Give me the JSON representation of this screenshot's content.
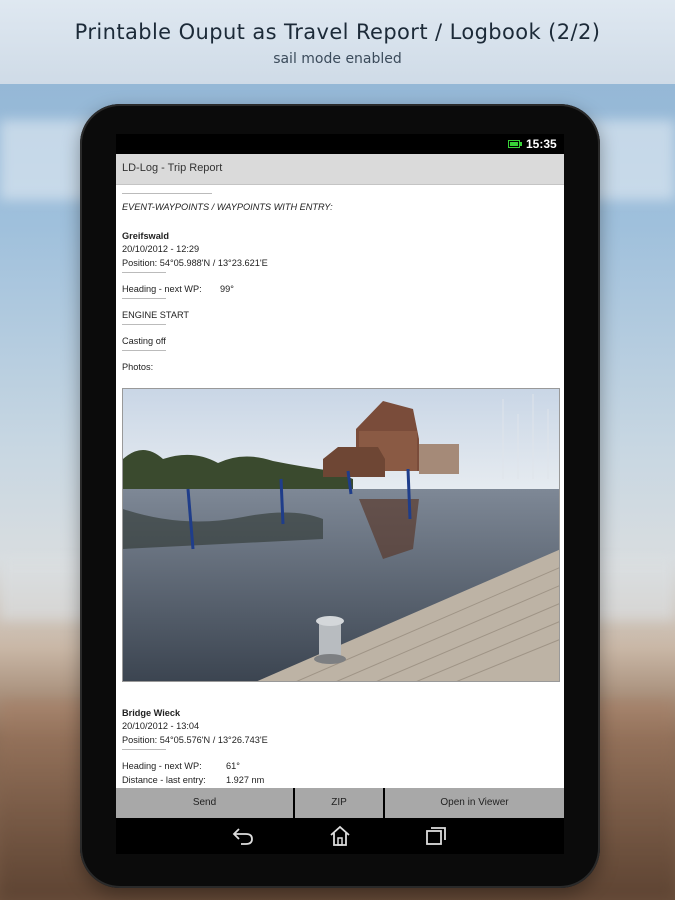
{
  "header": {
    "title": "Printable Ouput as Travel Report / Logbook (2/2)",
    "subtitle": "sail mode enabled"
  },
  "status_bar": {
    "time": "15:35"
  },
  "app_bar": {
    "title": "LD-Log - Trip Report"
  },
  "report": {
    "section_heading": "EVENT-WAYPOINTS / WAYPOINTS WITH ENTRY:",
    "waypoint1": {
      "name": "Greifswald",
      "datetime": "20/10/2012 - 12:29",
      "position": "Position: 54°05.988'N / 13°23.621'E",
      "heading": "Heading - next WP:",
      "heading_value": "99°",
      "event1": "ENGINE START",
      "event2": "Casting off",
      "photos_label": "Photos:"
    },
    "waypoint2": {
      "name": "Bridge Wieck",
      "datetime": "20/10/2012 - 13:04",
      "position": "Position: 54°05.576'N / 13°26.743'E",
      "heading": "Heading - next WP:",
      "heading_value": "61°",
      "distance": "Distance - last entry:",
      "distance_value": "1.927 nm"
    }
  },
  "buttons": {
    "send": "Send",
    "zip": "ZIP",
    "open_viewer": "Open in Viewer"
  },
  "icons": {
    "back": "back-icon",
    "home": "home-icon",
    "recents": "recents-icon",
    "battery": "battery-icon"
  },
  "colors": {
    "battery": "#38d238",
    "button_bg": "#a8a8a8",
    "appbar_bg": "#dadada"
  }
}
